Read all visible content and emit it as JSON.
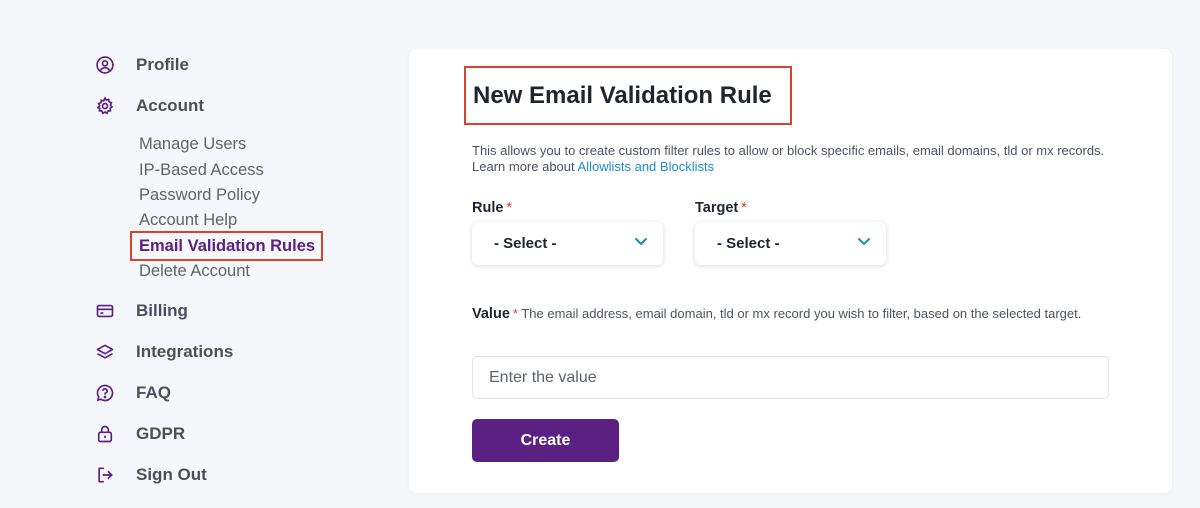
{
  "sidebar": {
    "items": [
      {
        "label": "Profile",
        "icon": "user-circle-icon"
      },
      {
        "label": "Account",
        "icon": "gear-icon"
      },
      {
        "label": "Billing",
        "icon": "credit-card-icon"
      },
      {
        "label": "Integrations",
        "icon": "layers-icon"
      },
      {
        "label": "FAQ",
        "icon": "question-icon"
      },
      {
        "label": "GDPR",
        "icon": "lock-icon"
      },
      {
        "label": "Sign Out",
        "icon": "sign-out-icon"
      }
    ],
    "account_sub_items": [
      {
        "label": "Manage Users"
      },
      {
        "label": "IP-Based Access"
      },
      {
        "label": "Password Policy"
      },
      {
        "label": "Account Help"
      },
      {
        "label": "Email Validation Rules",
        "active": true
      },
      {
        "label": "Delete Account"
      }
    ]
  },
  "form": {
    "title": "New Email Validation Rule",
    "description_line": "This allows you to create custom filter rules to allow or block specific emails, email domains, tld or mx records.",
    "learn_more_prefix": "Learn more about ",
    "learn_more_link": "Allowlists and Blocklists",
    "rule_label": "Rule",
    "target_label": "Target",
    "required_mark": "*",
    "rule_select_value": "- Select -",
    "target_select_value": "- Select -",
    "value_label": "Value",
    "value_help": "The email address, email domain, tld or mx record you wish to filter, based on the selected target.",
    "value_placeholder": "Enter the value",
    "create_label": "Create"
  },
  "colors": {
    "accent": "#5b2182",
    "highlight_box": "#d9422c",
    "link": "#1b8ec9",
    "background": "#f6f7fa"
  }
}
